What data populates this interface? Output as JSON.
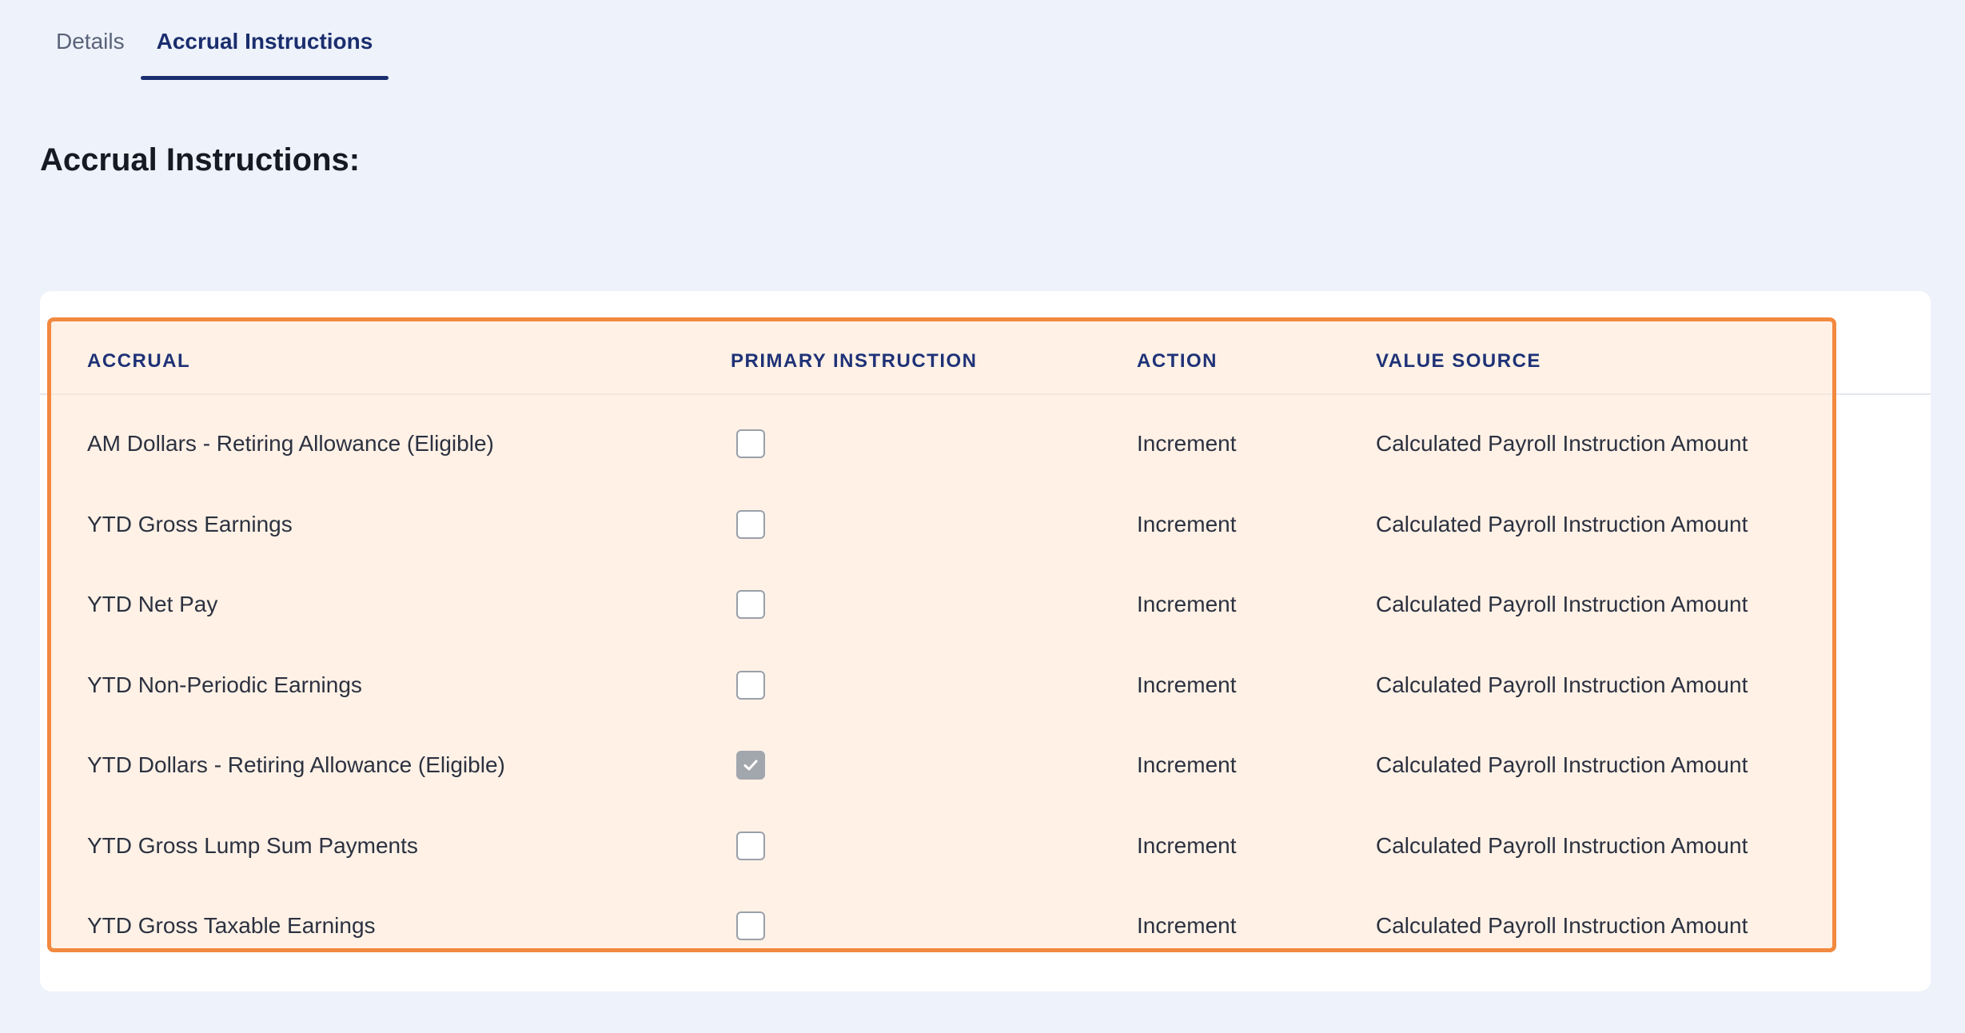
{
  "tabs": [
    {
      "label": "Details",
      "active": false
    },
    {
      "label": "Accrual Instructions",
      "active": true
    }
  ],
  "page_title": "Accrual Instructions:",
  "table": {
    "columns": [
      "ACCRUAL",
      "PRIMARY INSTRUCTION",
      "ACTION",
      "VALUE SOURCE"
    ],
    "rows": [
      {
        "accrual": "AM Dollars - Retiring Allowance (Eligible)",
        "primary": false,
        "action": "Increment",
        "value_source": "Calculated Payroll Instruction Amount"
      },
      {
        "accrual": "YTD Gross Earnings",
        "primary": false,
        "action": "Increment",
        "value_source": "Calculated Payroll Instruction Amount"
      },
      {
        "accrual": "YTD Net Pay",
        "primary": false,
        "action": "Increment",
        "value_source": "Calculated Payroll Instruction Amount"
      },
      {
        "accrual": "YTD Non-Periodic Earnings",
        "primary": false,
        "action": "Increment",
        "value_source": "Calculated Payroll Instruction Amount"
      },
      {
        "accrual": "YTD Dollars - Retiring Allowance (Eligible)",
        "primary": true,
        "action": "Increment",
        "value_source": "Calculated Payroll Instruction Amount"
      },
      {
        "accrual": "YTD Gross Lump Sum Payments",
        "primary": false,
        "action": "Increment",
        "value_source": "Calculated Payroll Instruction Amount"
      },
      {
        "accrual": "YTD Gross Taxable Earnings",
        "primary": false,
        "action": "Increment",
        "value_source": "Calculated Payroll Instruction Amount"
      }
    ]
  },
  "colors": {
    "highlight_border": "#f2893f",
    "active_tab": "#1a2e6e",
    "header_text": "#1f3277"
  }
}
